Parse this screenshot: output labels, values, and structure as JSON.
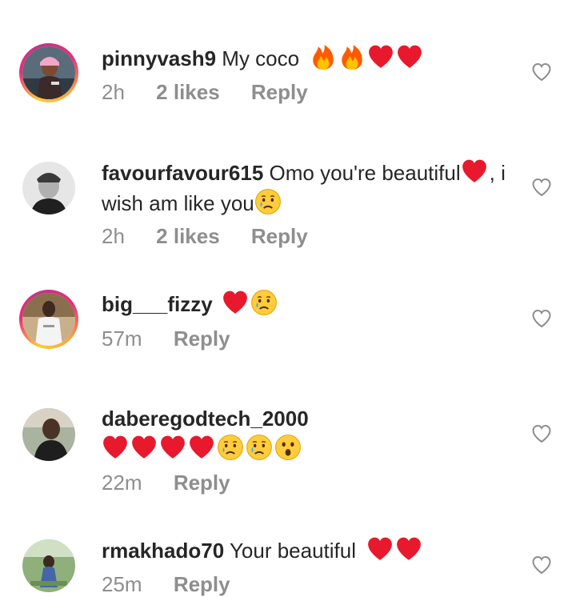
{
  "comments": [
    {
      "username": "pinnyvash9",
      "text": "My coco",
      "emojis": [
        "fire",
        "fire",
        "heart",
        "heart"
      ],
      "time": "2h",
      "likes": "2 likes",
      "reply": "Reply"
    },
    {
      "username": "favourfavour615",
      "text": "Omo you're beautiful",
      "text2": ", i wish am like you",
      "time": "2h",
      "likes": "2 likes",
      "reply": "Reply"
    },
    {
      "username": "big___fizzy",
      "text": "",
      "emojis": [
        "heart",
        "sad-tear"
      ],
      "time": "57m",
      "reply": "Reply"
    },
    {
      "username": "daberegodtech_2000",
      "text": "",
      "emojis": [
        "heart",
        "heart",
        "heart",
        "heart",
        "sad-tear",
        "sad-tear",
        "astonished"
      ],
      "time": "22m",
      "reply": "Reply"
    },
    {
      "username": "rmakhado70",
      "text": "Your beautiful",
      "emojis": [
        "heart",
        "heart"
      ],
      "time": "25m",
      "reply": "Reply"
    }
  ],
  "colors": {
    "text": "#262626",
    "muted": "#8e8e8e",
    "heart": "#e8192c",
    "fire": "#ff6a00"
  },
  "icons": {
    "like": "heart-outline-icon"
  }
}
